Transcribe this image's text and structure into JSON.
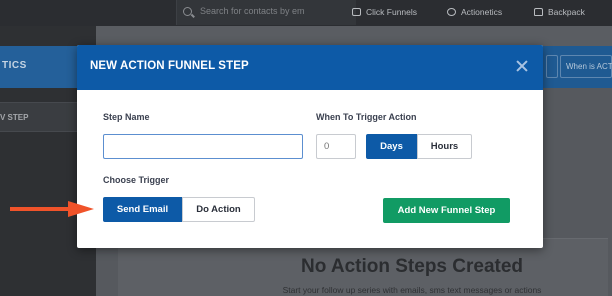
{
  "topbar": {
    "search_placeholder": "Search for contacts by em",
    "links": [
      {
        "label": "Click Funnels",
        "icon": "funnel-icon"
      },
      {
        "label": "Actionetics",
        "icon": "user-circle-icon"
      },
      {
        "label": "Backpack",
        "icon": "backpack-icon"
      }
    ]
  },
  "background": {
    "sidebar_title": "TICS",
    "sidebar_item": "V STEP",
    "header_buttons": [
      "",
      "When is ACTI"
    ],
    "empty_title": "No Action Steps Created",
    "empty_subtitle": "Start your follow up series with emails, sms text messages or actions"
  },
  "modal": {
    "title": "NEW ACTION FUNNEL STEP",
    "step_name_label": "Step Name",
    "step_name_value": "",
    "trigger_action_label": "When To Trigger Action",
    "trigger_amount_value": "0",
    "units": [
      {
        "label": "Days",
        "active": true
      },
      {
        "label": "Hours",
        "active": false
      }
    ],
    "choose_trigger_label": "Choose Trigger",
    "triggers": [
      {
        "label": "Send Email",
        "active": true
      },
      {
        "label": "Do Action",
        "active": false
      }
    ],
    "add_button_label": "Add New Funnel Step"
  },
  "colors": {
    "primary": "#0d5aa7",
    "success": "#119b64",
    "annotation": "#f0532a"
  }
}
